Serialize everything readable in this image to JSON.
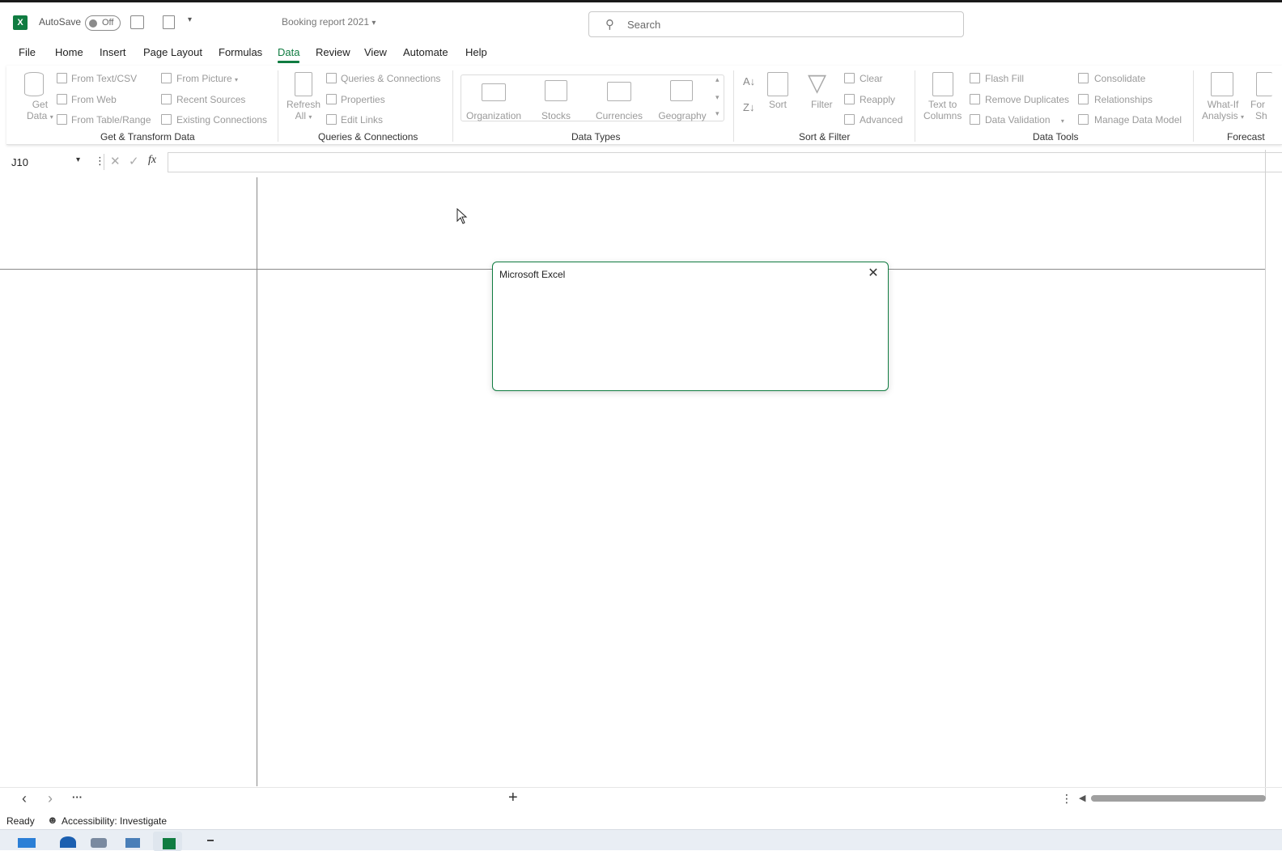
{
  "titlebar": {
    "app_logo": "X",
    "autosave_label": "AutoSave",
    "autosave_state": "Off",
    "doc_title": "Booking report 2021",
    "search_placeholder": "Search"
  },
  "menu": {
    "items": [
      "File",
      "Home",
      "Insert",
      "Page Layout",
      "Formulas",
      "Data",
      "Review",
      "View",
      "Automate",
      "Help"
    ],
    "active": "Data"
  },
  "ribbon": {
    "get_transform": {
      "get_data": [
        "Get",
        "Data"
      ],
      "from_text_csv": "From Text/CSV",
      "from_web": "From Web",
      "from_table_range": "From Table/Range",
      "from_picture": "From Picture",
      "recent_sources": "Recent Sources",
      "existing_connections": "Existing Connections",
      "label": "Get & Transform Data"
    },
    "queries": {
      "refresh_all": [
        "Refresh",
        "All"
      ],
      "queries_connections": "Queries & Connections",
      "properties": "Properties",
      "edit_links": "Edit Links",
      "label": "Queries & Connections"
    },
    "data_types": {
      "items": [
        "Organization",
        "Stocks",
        "Currencies",
        "Geography"
      ],
      "label": "Data Types"
    },
    "sort_filter": {
      "sort": "Sort",
      "filter": "Filter",
      "clear": "Clear",
      "reapply": "Reapply",
      "advanced": "Advanced",
      "label": "Sort & Filter"
    },
    "data_tools": {
      "text_to_columns": [
        "Text to",
        "Columns"
      ],
      "flash_fill": "Flash Fill",
      "remove_duplicates": "Remove Duplicates",
      "data_validation": "Data Validation",
      "consolidate": "Consolidate",
      "relationships": "Relationships",
      "manage_data_model": "Manage Data Model",
      "label": "Data Tools"
    },
    "forecast": {
      "what_if": [
        "What-If",
        "Analysis"
      ],
      "forecast_sheet": [
        "For",
        "Sh"
      ],
      "label": "Forecast"
    }
  },
  "formula_bar": {
    "name_box": "J10",
    "fx": "fx",
    "value": ""
  },
  "dialog": {
    "title": "Microsoft Excel",
    "close_glyph": "✕"
  },
  "sheet_nav": {
    "prev": "‹",
    "next": "›",
    "more": "···",
    "add": "+"
  },
  "status": {
    "ready": "Ready",
    "accessibility": "Accessibility: Investigate"
  },
  "colors": {
    "accent": "#107c41",
    "disabled_text": "#9a9a9a"
  }
}
